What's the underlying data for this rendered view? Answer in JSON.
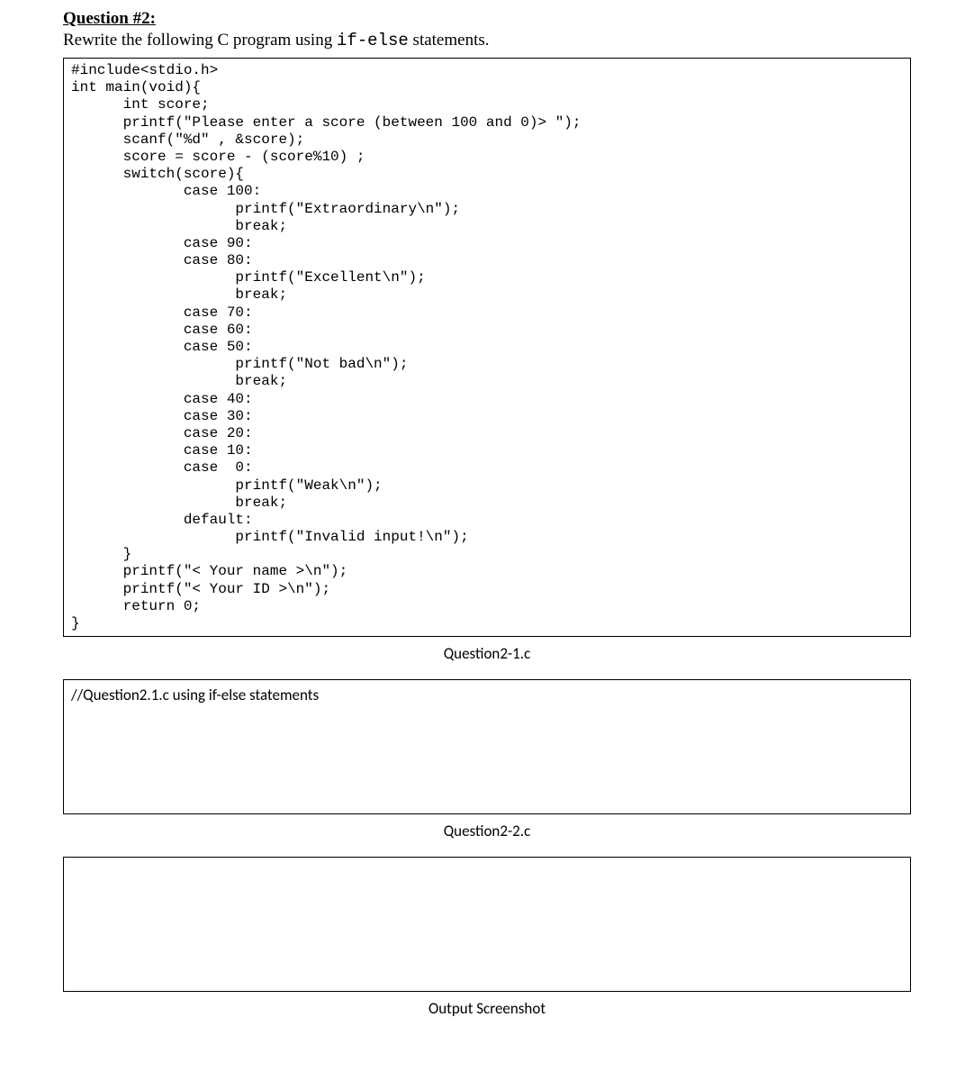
{
  "heading": "Question #2:",
  "instruction_pre": "Rewrite the following C program using ",
  "instruction_code": "if-else",
  "instruction_post": " statements.",
  "code_block": "#include<stdio.h>\nint main(void){\n      int score;\n      printf(\"Please enter a score (between 100 and 0)> \");\n      scanf(\"%d\" , &score);\n      score = score - (score%10) ;\n      switch(score){\n             case 100:\n                   printf(\"Extraordinary\\n\");\n                   break;\n             case 90:\n             case 80:\n                   printf(\"Excellent\\n\");\n                   break;\n             case 70:\n             case 60:\n             case 50:\n                   printf(\"Not bad\\n\");\n                   break;\n             case 40:\n             case 30:\n             case 20:\n             case 10:\n             case  0:\n                   printf(\"Weak\\n\");\n                   break;\n             default:\n                   printf(\"Invalid input!\\n\");\n      }\n      printf(\"< Your name >\\n\");\n      printf(\"< Your ID >\\n\");\n      return 0;\n}",
  "caption1": "Question2-1.c",
  "answer_box_text": "//Question2.1.c using if-else statements",
  "caption2": "Question2-2.c",
  "caption3": "Output Screenshot"
}
